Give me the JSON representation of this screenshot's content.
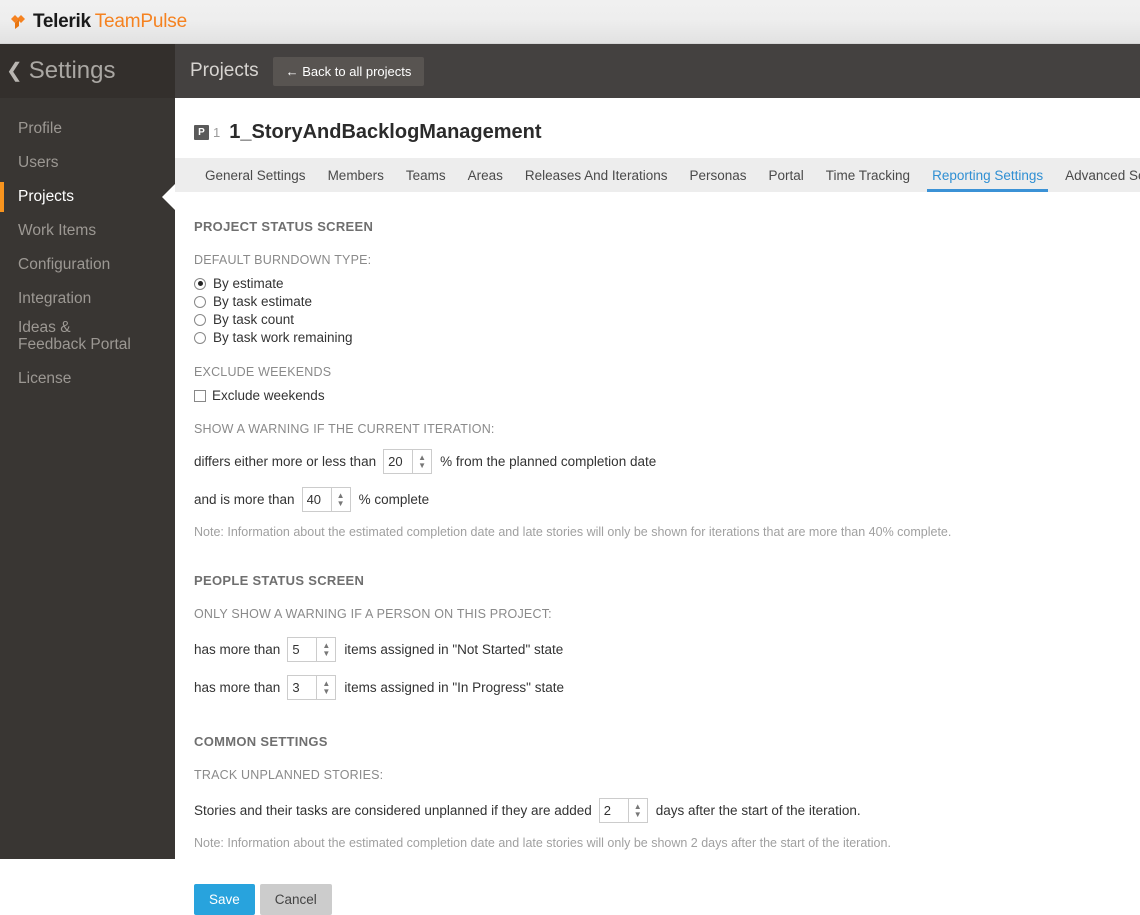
{
  "brand": {
    "logo_icon": "telerik-diamond-icon",
    "name_primary": "Telerik",
    "name_secondary": "TeamPulse",
    "accent_color": "#f58220"
  },
  "sidebar": {
    "back_icon": "chevron-left-icon",
    "title": "Settings",
    "items": [
      {
        "label": "Profile",
        "active": false
      },
      {
        "label": "Users",
        "active": false
      },
      {
        "label": "Projects",
        "active": true
      },
      {
        "label": "Work Items",
        "active": false
      },
      {
        "label": "Configuration",
        "active": false
      },
      {
        "label": "Integration",
        "active": false
      },
      {
        "label": "Ideas & Feedback Portal",
        "active": false
      },
      {
        "label": "License",
        "active": false
      }
    ],
    "active_marker_color": "#f7941e"
  },
  "topbar": {
    "title": "Projects",
    "back_button": "← Back to all projects"
  },
  "project": {
    "badge": "P",
    "number": "1",
    "name": "1_StoryAndBacklogManagement"
  },
  "tabs": [
    {
      "label": "General Settings",
      "active": false
    },
    {
      "label": "Members",
      "active": false
    },
    {
      "label": "Teams",
      "active": false
    },
    {
      "label": "Areas",
      "active": false
    },
    {
      "label": "Releases And Iterations",
      "active": false
    },
    {
      "label": "Personas",
      "active": false
    },
    {
      "label": "Portal",
      "active": false
    },
    {
      "label": "Time Tracking",
      "active": false
    },
    {
      "label": "Reporting Settings",
      "active": true
    },
    {
      "label": "Advanced Settings",
      "active": false
    }
  ],
  "tab_active_color": "#3b92d6",
  "project_status": {
    "section_title": "PROJECT STATUS SCREEN",
    "burndown_label": "DEFAULT BURNDOWN TYPE:",
    "burndown_options": [
      {
        "label": "By estimate",
        "selected": true
      },
      {
        "label": "By task estimate",
        "selected": false
      },
      {
        "label": "By task count",
        "selected": false
      },
      {
        "label": "By task work remaining",
        "selected": false
      }
    ],
    "exclude_weekends_label": "EXCLUDE WEEKENDS",
    "exclude_weekends_checkbox": "Exclude weekends",
    "exclude_weekends_checked": false,
    "warning_label": "SHOW A WARNING IF THE CURRENT ITERATION:",
    "row1_prefix": "differs either more or less than",
    "row1_value": "20",
    "row1_suffix": "% from the planned completion date",
    "row2_prefix": "and is more than",
    "row2_value": "40",
    "row2_suffix": "% complete",
    "note": "Note: Information about the estimated completion date and late stories will only be shown for iterations that are more than 40% complete."
  },
  "people_status": {
    "section_title": "PEOPLE STATUS SCREEN",
    "warning_label": "ONLY SHOW A WARNING IF A PERSON ON THIS PROJECT:",
    "row1_prefix": "has more than",
    "row1_value": "5",
    "row1_suffix": "items assigned in \"Not Started\" state",
    "row2_prefix": "has more than",
    "row2_value": "3",
    "row2_suffix": "items assigned in \"In Progress\" state"
  },
  "common_settings": {
    "section_title": "COMMON SETTINGS",
    "track_label": "TRACK UNPLANNED STORIES:",
    "row_prefix": "Stories and their tasks are considered unplanned if they are added",
    "row_value": "2",
    "row_suffix": "days after the start of the iteration.",
    "note": "Note: Information about the estimated completion date and late stories will only be shown 2 days after the start of the iteration."
  },
  "actions": {
    "save_label": "Save",
    "cancel_label": "Cancel",
    "save_color": "#28a3dd"
  },
  "spinner_icons": {
    "up": "chevron-up-icon",
    "down": "chevron-down-icon"
  }
}
